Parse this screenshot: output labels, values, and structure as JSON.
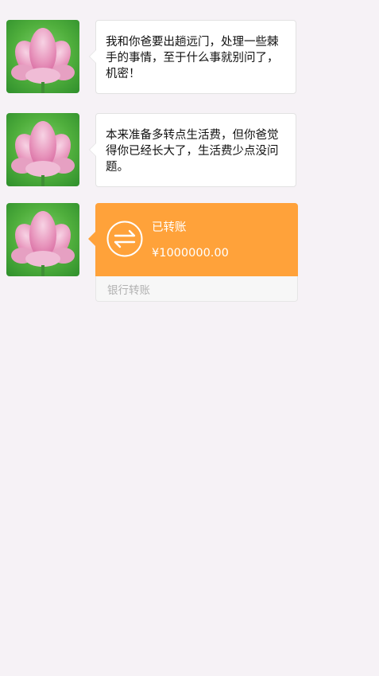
{
  "messages": [
    {
      "avatar_icon": "lotus-flower-avatar",
      "text": "我和你爸要出趟远门，处理一些棘手的事情，至于什么事就别问了，机密！"
    },
    {
      "avatar_icon": "lotus-flower-avatar",
      "text": "本来准备多转点生活费，但你爸觉得你已经长大了，生活费少点没问题。"
    }
  ],
  "transfer": {
    "avatar_icon": "lotus-flower-avatar",
    "icon": "transfer-arrows-icon",
    "status": "已转账",
    "amount": "¥1000000.00",
    "bank_label": "银行转账",
    "color": "#ffa23a"
  }
}
